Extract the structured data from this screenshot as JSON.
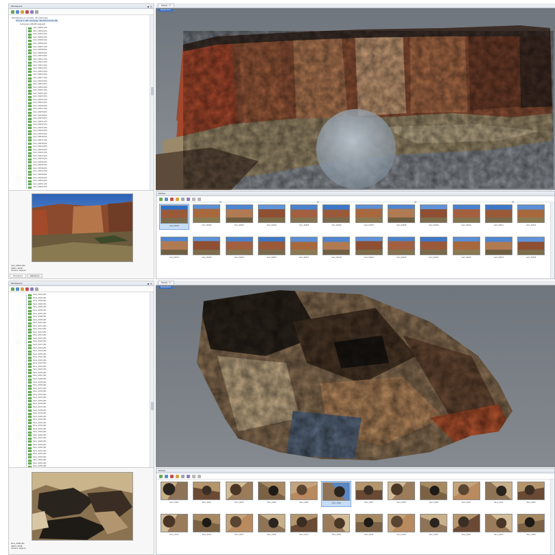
{
  "colors": {
    "viewport_bg": "#787d84",
    "selection_blue": "#3a6fc4",
    "aligned_green": "#7fc466"
  },
  "icons": [
    "new-icon",
    "open-icon",
    "save-icon",
    "undo-icon",
    "delete-icon",
    "zoom-icon"
  ],
  "top": {
    "workspace": {
      "title": "Workspace",
      "root": "Workspace (1 chunks, 28 cameras)",
      "chunk": "Chunk 1 (28 cameras, 48,923 points) [R]",
      "group": "Cameras (28/28 aligned)",
      "cameras": [
        "Cam_00001.JPG",
        "Cam_00002.JPG",
        "Cam_00003.JPG",
        "Cam_00004.JPG",
        "Cam_00005.JPG",
        "Cam_00006.JPG",
        "Cam_00007.JPG",
        "Cam_00008.JPG",
        "Cam_00009.JPG",
        "Cam_00010.JPG",
        "Cam_00011.JPG",
        "Cam_00012.JPG",
        "Cam_00013.JPG",
        "Cam_00014.JPG",
        "Cam_00015.JPG",
        "Cam_00016.JPG",
        "Cam_00017.JPG",
        "Cam_00018.JPG",
        "Cam_00019.JPG",
        "Cam_00020.JPG",
        "Cam_00021.JPG",
        "Cam_00022.JPG",
        "Cam_00023.JPG",
        "Cam_00024.JPG",
        "Cam_00025.JPG",
        "Cam_00026.JPG",
        "Cam_00027.JPG",
        "Cam_00028.JPG",
        "Cam_00029.JPG",
        "Cam_00030.JPG",
        "Cam_00031.JPG",
        "Cam_00032.JPG",
        "Cam_00033.JPG",
        "Cam_00034.JPG",
        "Cam_00035.JPG",
        "Cam_00036.JPG",
        "Cam_00037.JPG",
        "Cam_00038.JPG",
        "Cam_00039.JPG",
        "Cam_00040.JPG",
        "Cam_00041.JPG",
        "Cam_00042.JPG",
        "Cam_00043.JPG",
        "Cam_00044.JPG",
        "Cam_00045.JPG",
        "Cam_00046.JPG",
        "Cam_00047.JPG",
        "Cam_00048.JPG",
        "Cam_00049.JPG",
        "Cam_00050.JPG",
        "Cam_00051.JPG",
        "Cam_00052.JPG"
      ],
      "info": [
        "Cam_00001.JPG",
        "4288 x 2848",
        "Camera: aligned"
      ],
      "tabs": [
        "Workspace",
        "Reference"
      ]
    },
    "model_tab": "Model",
    "model_sub": "Perspective",
    "photos_title": "Photos",
    "photos": [
      "Cam_00001",
      "Cam_00002",
      "Cam_00003",
      "Cam_00004",
      "Cam_00005",
      "Cam_00006",
      "Cam_00007",
      "Cam_00008",
      "Cam_00009",
      "Cam_00010",
      "Cam_00011",
      "Cam_00012",
      "Cam_00013",
      "Cam_00014",
      "Cam_00015",
      "Cam_00016",
      "Cam_00017",
      "Cam_00018",
      "Cam_00019",
      "Cam_00020",
      "Cam_00021",
      "Cam_00022",
      "Cam_00023",
      "Cam_00024"
    ]
  },
  "bottom": {
    "workspace": {
      "title": "Workspace",
      "cameras": [
        "Pano_0001.JPG",
        "Pano_0002.JPG",
        "Pano_0003.JPG",
        "Pano_0004.JPG",
        "Pano_0005.JPG",
        "Pano_0006.JPG",
        "Pano_0007.JPG",
        "Pano_0008.JPG",
        "Pano_0009.JPG",
        "Pano_0010.JPG",
        "Pano_0011.JPG",
        "Pano_0012.JPG",
        "Pano_0013.JPG",
        "Pano_0014.JPG",
        "Pano_0015.JPG",
        "Pano_0016.JPG",
        "Pano_0017.JPG",
        "Pano_0018.JPG",
        "Pano_0019.JPG",
        "Pano_0020.JPG",
        "Pano_0021.JPG",
        "Pano_0022.JPG",
        "Pano_0023.JPG",
        "Pano_0024.JPG",
        "Pano_0025.JPG",
        "Pano_0026.JPG",
        "Pano_0027.JPG",
        "Pano_0028.JPG",
        "Pano_0029.JPG",
        "Pano_0030.JPG",
        "Pano_0031.JPG",
        "Pano_0032.JPG",
        "Pano_0033.JPG",
        "Pano_0034.JPG",
        "Pano_0035.JPG",
        "Pano_0036.JPG",
        "Pano_0037.JPG",
        "Pano_0038.JPG",
        "Pano_0039.JPG",
        "Pano_0040.JPG",
        "Pano_0041.JPG",
        "Pano_0042.JPG",
        "Pano_0043.JPG",
        "Pano_0044.JPG",
        "Pano_0045.JPG",
        "Pano_0046.JPG",
        "Pano_0047.JPG",
        "Pano_0048.JPG",
        "Pano_0049.JPG",
        "Pano_0050.JPG",
        "Pano_0051.JPG",
        "Pano_0052.JPG",
        "Pano_0053.JPG",
        "Pano_0054.JPG",
        "Pano_0055.JPG",
        "Pano_0056.JPG"
      ],
      "info": [
        "Pano_0006.JPG",
        "4288 x 2848",
        "Camera: aligned"
      ]
    },
    "model_tab": "Model",
    "model_sub": "Perspective",
    "photos_title": "Photos",
    "photos": [
      "Pano_0001",
      "Pano_0002",
      "Pano_0003",
      "Pano_0004",
      "Pano_0005",
      "Pano_0006",
      "Pano_0007",
      "Pano_0008",
      "Pano_0009",
      "Pano_0010",
      "Pano_0011",
      "Pano_0012",
      "Pano_0013",
      "Pano_0014",
      "Pano_0015",
      "Pano_0016",
      "Pano_0017",
      "Pano_0018",
      "Pano_0019",
      "Pano_0020",
      "Pano_0021",
      "Pano_0022",
      "Pano_0023",
      "Pano_0024"
    ]
  }
}
